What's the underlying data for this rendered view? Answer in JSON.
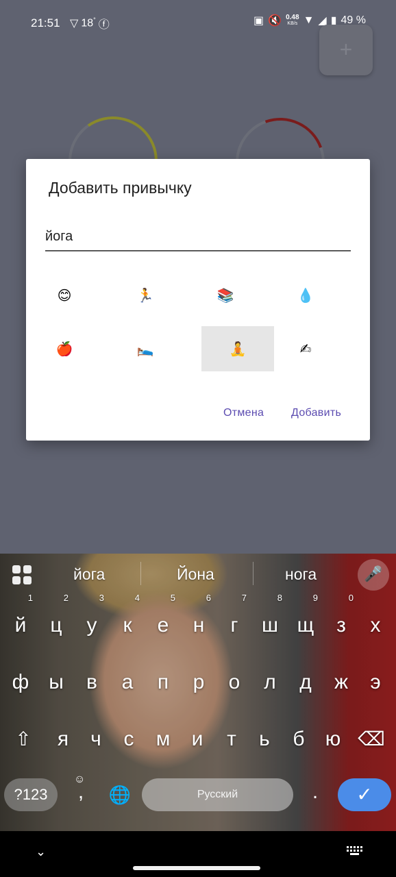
{
  "status_bar": {
    "time": "21:51",
    "temperature": "18",
    "degree": "°",
    "netspeed_value": "0.48",
    "netspeed_unit": "KB/s",
    "battery": "49 %"
  },
  "dialog": {
    "title": "Добавить привычку",
    "input_value": "йога",
    "emojis": [
      "😊",
      "🏃",
      "📚",
      "💧",
      "🍎",
      "🛌",
      "🧘",
      "✍"
    ],
    "selected_index": 6,
    "cancel_label": "Отмена",
    "add_label": "Добавить"
  },
  "keyboard": {
    "suggestions": [
      "йога",
      "Йона",
      "нога"
    ],
    "row1": [
      "й",
      "ц",
      "у",
      "к",
      "е",
      "н",
      "г",
      "ш",
      "щ",
      "з",
      "х"
    ],
    "row1_hints": [
      "1",
      "2",
      "3",
      "4",
      "5",
      "6",
      "7",
      "8",
      "9",
      "0",
      ""
    ],
    "row2": [
      "ф",
      "ы",
      "в",
      "а",
      "п",
      "р",
      "о",
      "л",
      "д",
      "ж",
      "э"
    ],
    "row3": [
      "я",
      "ч",
      "с",
      "м",
      "и",
      "т",
      "ь",
      "б",
      "ю"
    ],
    "symbols_label": "?123",
    "comma": ",",
    "space_label": "Русский",
    "period": "."
  }
}
